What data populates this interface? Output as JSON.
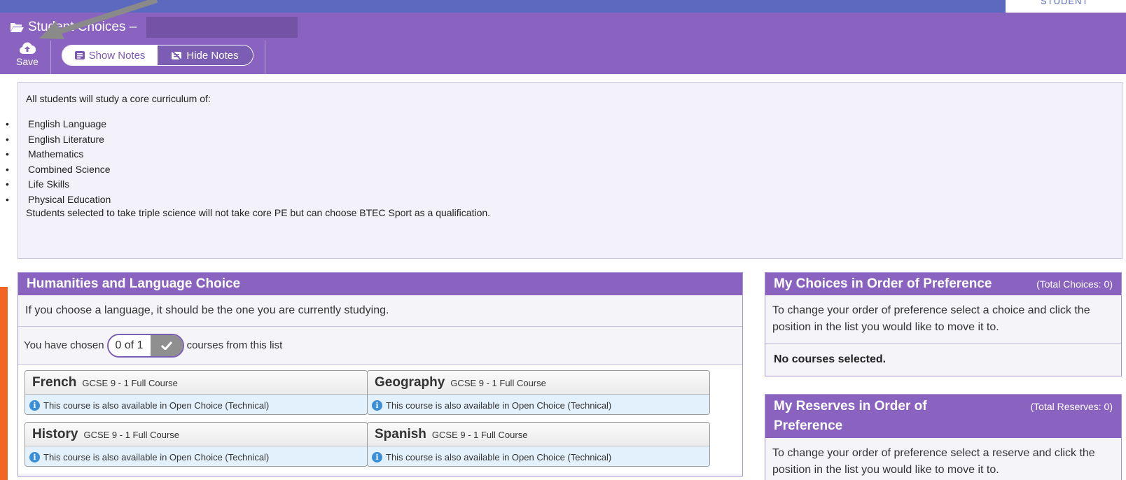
{
  "topbar": {
    "user_label": "STUDENT"
  },
  "header": {
    "title": "Student Choices –",
    "save_label": "Save",
    "show_notes_label": "Show Notes",
    "hide_notes_label": "Hide Notes"
  },
  "notes": {
    "intro": "All students will study a core curriculum of:",
    "items": [
      "English Language",
      "English Literature",
      "Mathematics",
      "Combined Science",
      "Life Skills",
      "Physical Education"
    ],
    "outro": "Students selected to take triple science will not take core PE but can choose BTEC Sport as a qualification."
  },
  "humanities": {
    "title": "Humanities and Language Choice",
    "description": "If you choose a language, it should be the one you are currently studying.",
    "chosen_prefix": "You have chosen",
    "chosen_count": "0 of 1",
    "chosen_suffix": "courses from this list",
    "courses": [
      {
        "name": "French",
        "qualification": "GCSE 9 - 1 Full Course",
        "info": "This course is also available in Open Choice (Technical)"
      },
      {
        "name": "Geography",
        "qualification": "GCSE 9 - 1 Full Course",
        "info": "This course is also available in Open Choice (Technical)"
      },
      {
        "name": "History",
        "qualification": "GCSE 9 - 1 Full Course",
        "info": "This course is also available in Open Choice (Technical)"
      },
      {
        "name": "Spanish",
        "qualification": "GCSE 9 - 1 Full Course",
        "info": "This course is also available in Open Choice (Technical)"
      }
    ]
  },
  "choices": {
    "title": "My Choices in Order of Preference",
    "total": "(Total Choices: 0)",
    "instructions": "To change your order of preference select a choice and click the position in the list you would like to move it to.",
    "empty": "No courses selected."
  },
  "reserves": {
    "title": "My Reserves in Order of Preference",
    "total": "(Total Reserves: 0)",
    "instructions": "To change your order of preference select a reserve and click the position in the list you would like to move it to."
  },
  "colors": {
    "header": "#8a62bf",
    "topbar": "#5b6abf",
    "accent_orange": "#f26522",
    "info": "#3a8fd8"
  }
}
